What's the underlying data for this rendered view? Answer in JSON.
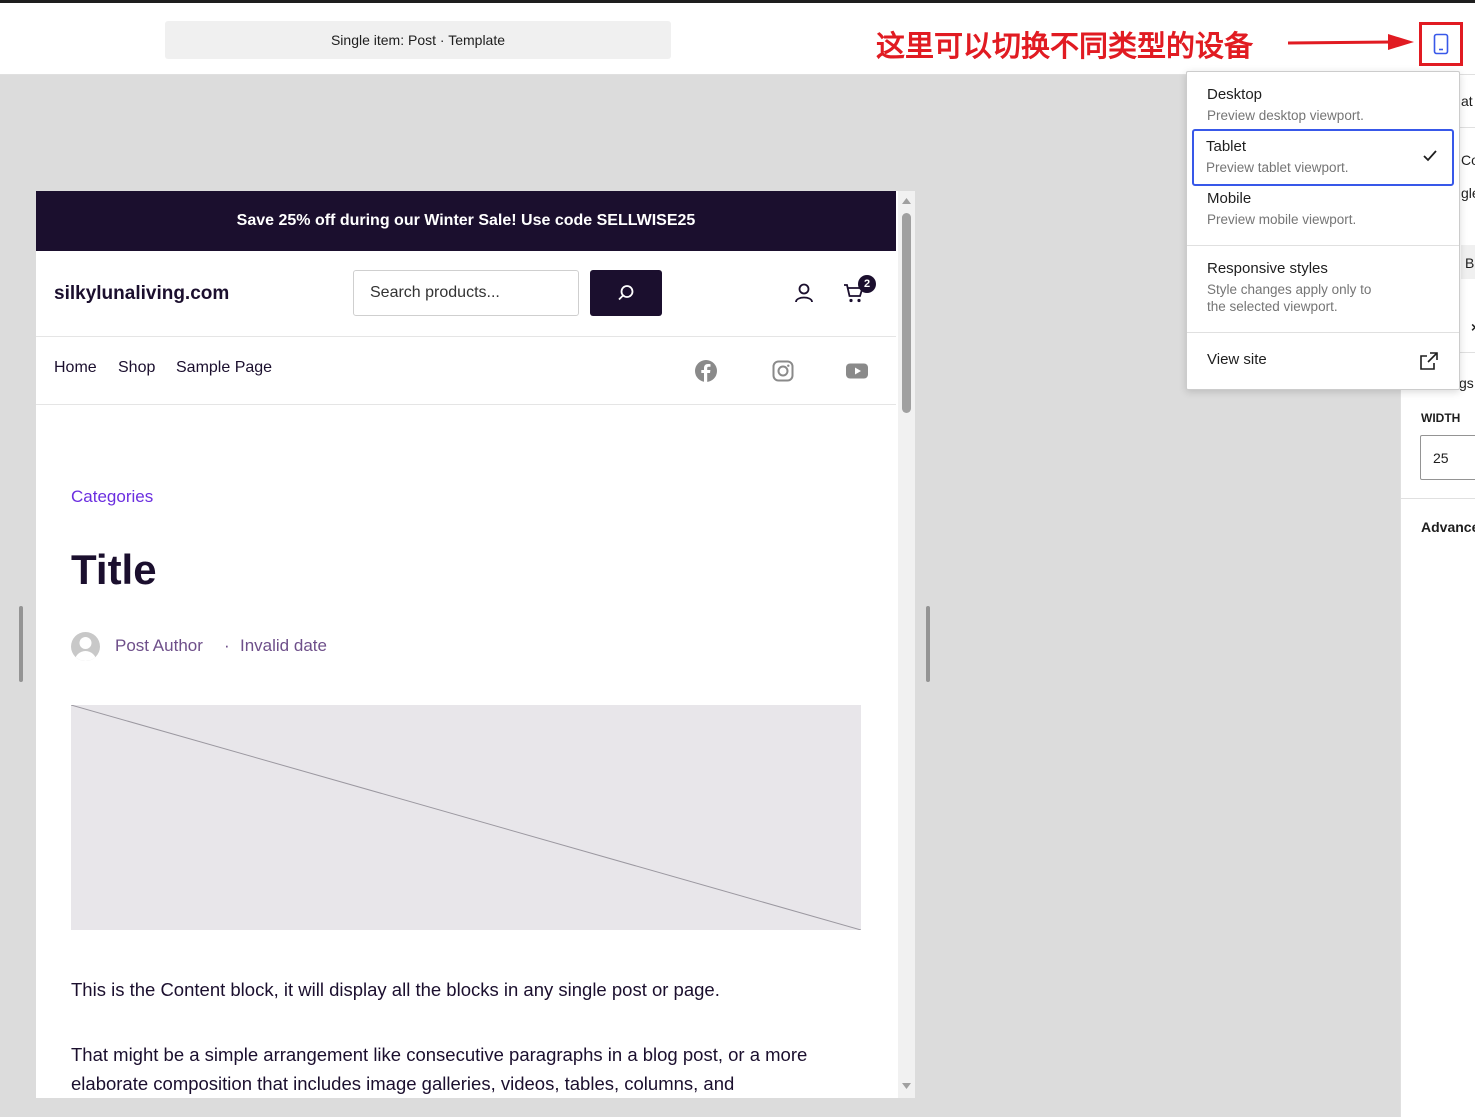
{
  "topbar": {
    "document_title": "Single item: Post · Template",
    "annotation": "这里可以切换不同类型的设备",
    "device_button_icon": "tablet-icon"
  },
  "device_menu": {
    "items": [
      {
        "label": "Desktop",
        "description": "Preview desktop viewport.",
        "selected": false
      },
      {
        "label": "Tablet",
        "description": "Preview tablet viewport.",
        "selected": true
      },
      {
        "label": "Mobile",
        "description": "Preview mobile viewport.",
        "selected": false
      }
    ],
    "responsive": {
      "label": "Responsive styles",
      "description": "Style changes apply only to the selected viewport."
    },
    "view_site": {
      "label": "View site",
      "icon": "external-link-icon"
    }
  },
  "sidebar": {
    "frag_1": "at",
    "frag_2": "Co",
    "frag_3": "gle",
    "frag_4": "Bl",
    "frag_5": "gs",
    "width_label": "WIDTH",
    "width_value": "25",
    "advanced": "Advanced"
  },
  "site": {
    "promo": "Save 25% off during our Winter Sale! Use code SELLWISE25",
    "name": "silkylunaliving.com",
    "search_placeholder": "Search products...",
    "cart_count": "2",
    "nav": [
      "Home",
      "Shop",
      "Sample Page"
    ],
    "social_icons": [
      "facebook-icon",
      "instagram-icon",
      "youtube-icon"
    ],
    "categories": "Categories",
    "title": "Title",
    "author": "Post Author",
    "separator": "·",
    "date": "Invalid date",
    "content_1": "This is the Content block, it will display all the blocks in any single post or page.",
    "content_2": "That might be a simple arrangement like consecutive paragraphs in a blog post, or a more elaborate composition that includes image galleries, videos, tables, columns, and"
  },
  "colors": {
    "accent": "#3858e9",
    "annotation_red": "#e11b22",
    "brand_dark": "#1b0f2e",
    "category_purple": "#6b2ee0"
  }
}
